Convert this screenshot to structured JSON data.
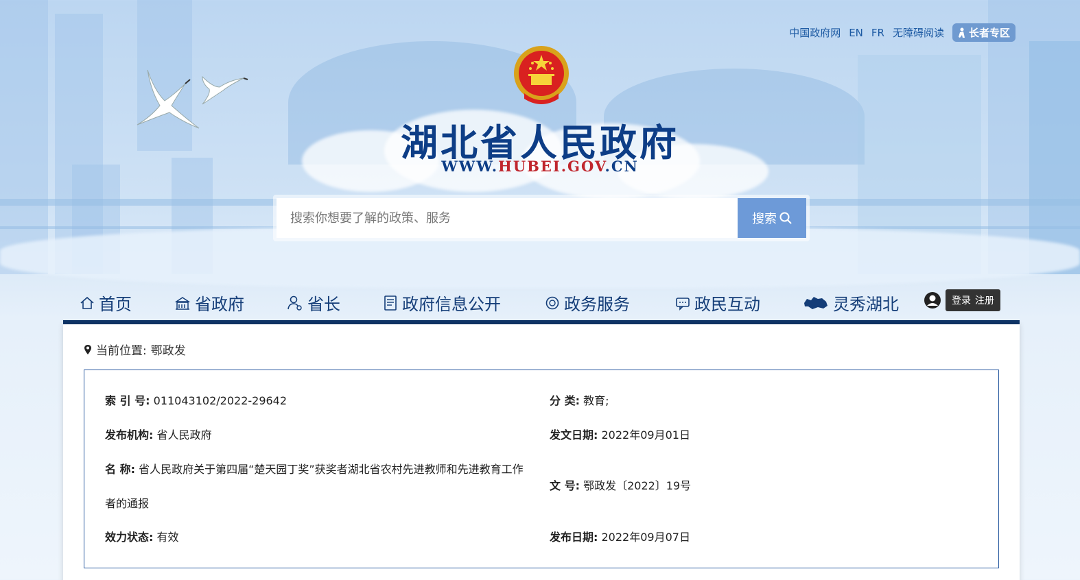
{
  "top_links": {
    "gov_cn": "中国政府网",
    "en": "EN",
    "fr": "FR",
    "accessible": "无障碍阅读",
    "elder": "长者专区"
  },
  "site": {
    "title": "湖北省人民政府",
    "url_pre": "WWW.",
    "url_mid": "HUBEI.GOV",
    "url_post": ".CN"
  },
  "search": {
    "placeholder": "搜索你想要了解的政策、服务",
    "button": "搜索"
  },
  "nav": {
    "items": [
      {
        "label": "首页",
        "icon": "home-icon"
      },
      {
        "label": "省政府",
        "icon": "building-icon"
      },
      {
        "label": "省长",
        "icon": "person-icon"
      },
      {
        "label": "政府信息公开",
        "icon": "document-icon"
      },
      {
        "label": "政务服务",
        "icon": "service-icon"
      },
      {
        "label": "政民互动",
        "icon": "chat-icon"
      },
      {
        "label": "灵秀湖北",
        "icon": "map-icon"
      }
    ],
    "login": "登录",
    "register": "注册"
  },
  "breadcrumb": {
    "prefix": "当前位置:",
    "current": "鄂政发"
  },
  "info": {
    "index_label": "索 引 号:",
    "index_value": "011043102/2022-29642",
    "category_label": "分 类:",
    "category_value": "教育;",
    "org_label": "发布机构:",
    "org_value": "省人民政府",
    "issue_date_label": "发文日期:",
    "issue_date_value": "2022年09月01日",
    "name_label": "名 称:",
    "name_value": "省人民政府关于第四届“楚天园丁奖”获奖者湖北省农村先进教师和先进教育工作者的通报",
    "doc_no_label": "文 号:",
    "doc_no_value": "鄂政发〔2022〕19号",
    "status_label": "效力状态:",
    "status_value": "有效",
    "publish_date_label": "发布日期:",
    "publish_date_value": "2022年09月07日"
  },
  "colors": {
    "title": "#0d3d86",
    "accent_red": "#c0262d",
    "nav_bar": "#0f3568",
    "search_button": "#6d9ad8"
  }
}
